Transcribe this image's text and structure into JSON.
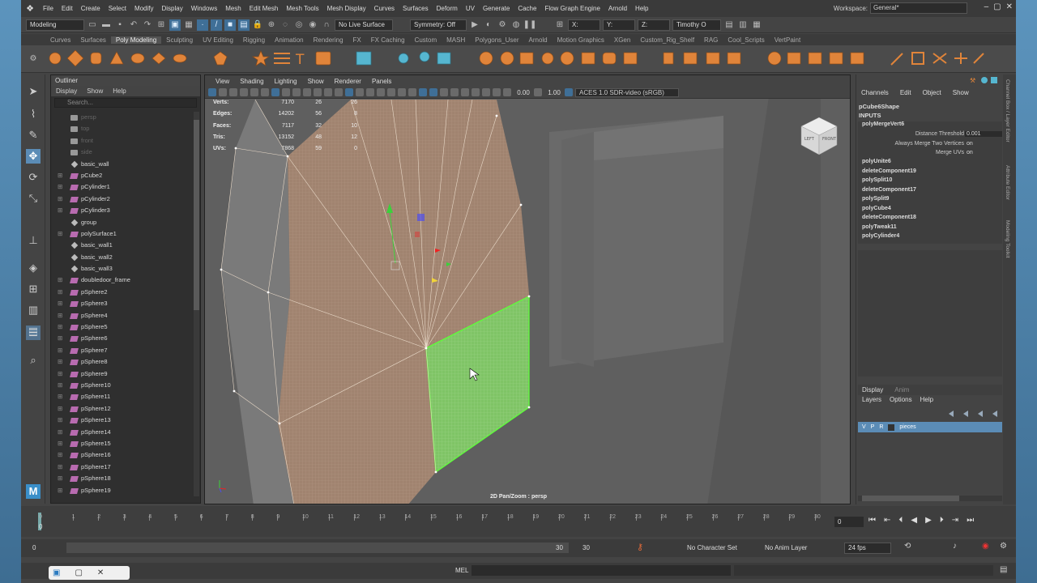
{
  "menubar": {
    "items": [
      "File",
      "Edit",
      "Create",
      "Select",
      "Modify",
      "Display",
      "Windows",
      "Mesh",
      "Edit Mesh",
      "Mesh Tools",
      "Mesh Display",
      "Curves",
      "Surfaces",
      "Deform",
      "UV",
      "Generate",
      "Cache",
      "Flow Graph Engine",
      "Arnold",
      "Help"
    ],
    "workspace_label": "Workspace:",
    "workspace_value": "General*"
  },
  "statusline": {
    "mode": "Modeling",
    "live_surface": "No Live Surface",
    "symmetry": "Symmetry: Off",
    "user": "Timothy O"
  },
  "shelf": {
    "tabs": [
      "Curves",
      "Surfaces",
      "Poly Modeling",
      "Sculpting",
      "UV Editing",
      "Rigging",
      "Animation",
      "Rendering",
      "FX",
      "FX Caching",
      "Custom",
      "MASH",
      "Polygons_User",
      "Arnold",
      "Motion Graphics",
      "XGen",
      "Custom_Rig_Shelf",
      "RAG",
      "Cool_Scripts",
      "VertPaint"
    ],
    "active_tab": "Poly Modeling"
  },
  "outliner": {
    "title": "Outliner",
    "menu": [
      "Display",
      "Show",
      "Help"
    ],
    "search_placeholder": "Search...",
    "items": [
      {
        "label": "persp",
        "icon": "cam",
        "dim": true
      },
      {
        "label": "top",
        "icon": "cam",
        "dim": true
      },
      {
        "label": "front",
        "icon": "cam",
        "dim": true
      },
      {
        "label": "side",
        "icon": "cam",
        "dim": true
      },
      {
        "label": "basic_wall",
        "icon": "grp",
        "dim": false
      },
      {
        "label": "pCube2",
        "icon": "mesh",
        "dim": false,
        "exp": true
      },
      {
        "label": "pCylinder1",
        "icon": "mesh",
        "dim": false,
        "exp": true
      },
      {
        "label": "pCylinder2",
        "icon": "mesh",
        "dim": false,
        "exp": true
      },
      {
        "label": "pCylinder3",
        "icon": "mesh",
        "dim": false,
        "exp": true
      },
      {
        "label": "group",
        "icon": "grp",
        "dim": false
      },
      {
        "label": "polySurface1",
        "icon": "mesh",
        "dim": false,
        "exp": true
      },
      {
        "label": "basic_wall1",
        "icon": "grp",
        "dim": false
      },
      {
        "label": "basic_wall2",
        "icon": "grp",
        "dim": false
      },
      {
        "label": "basic_wall3",
        "icon": "grp",
        "dim": false
      },
      {
        "label": "doubledoor_frame",
        "icon": "mesh",
        "dim": false,
        "exp": true
      },
      {
        "label": "pSphere2",
        "icon": "mesh",
        "dim": false,
        "exp": true
      },
      {
        "label": "pSphere3",
        "icon": "mesh",
        "dim": false,
        "exp": true
      },
      {
        "label": "pSphere4",
        "icon": "mesh",
        "dim": false,
        "exp": true
      },
      {
        "label": "pSphere5",
        "icon": "mesh",
        "dim": false,
        "exp": true
      },
      {
        "label": "pSphere6",
        "icon": "mesh",
        "dim": false,
        "exp": true
      },
      {
        "label": "pSphere7",
        "icon": "mesh",
        "dim": false,
        "exp": true
      },
      {
        "label": "pSphere8",
        "icon": "mesh",
        "dim": false,
        "exp": true
      },
      {
        "label": "pSphere9",
        "icon": "mesh",
        "dim": false,
        "exp": true
      },
      {
        "label": "pSphere10",
        "icon": "mesh",
        "dim": false,
        "exp": true
      },
      {
        "label": "pSphere11",
        "icon": "mesh",
        "dim": false,
        "exp": true
      },
      {
        "label": "pSphere12",
        "icon": "mesh",
        "dim": false,
        "exp": true
      },
      {
        "label": "pSphere13",
        "icon": "mesh",
        "dim": false,
        "exp": true
      },
      {
        "label": "pSphere14",
        "icon": "mesh",
        "dim": false,
        "exp": true
      },
      {
        "label": "pSphere15",
        "icon": "mesh",
        "dim": false,
        "exp": true
      },
      {
        "label": "pSphere16",
        "icon": "mesh",
        "dim": false,
        "exp": true
      },
      {
        "label": "pSphere17",
        "icon": "mesh",
        "dim": false,
        "exp": true
      },
      {
        "label": "pSphere18",
        "icon": "mesh",
        "dim": false,
        "exp": true
      },
      {
        "label": "pSphere19",
        "icon": "mesh",
        "dim": false,
        "exp": true
      }
    ]
  },
  "viewport": {
    "menu": [
      "View",
      "Shading",
      "Lighting",
      "Show",
      "Renderer",
      "Panels"
    ],
    "exposure": "0.00",
    "gamma": "1.00",
    "colorspace": "ACES 1.0 SDR-video (sRGB)",
    "camera_label": "2D Pan/Zoom : persp",
    "hud": [
      {
        "k": "Verts:",
        "a": "7170",
        "b": "26",
        "c": "26"
      },
      {
        "k": "Edges:",
        "a": "14202",
        "b": "56",
        "c": "8"
      },
      {
        "k": "Faces:",
        "a": "7117",
        "b": "32",
        "c": "10"
      },
      {
        "k": "Tris:",
        "a": "13152",
        "b": "48",
        "c": "12"
      },
      {
        "k": "UVs:",
        "a": "7868",
        "b": "59",
        "c": "0"
      }
    ],
    "viewcube": {
      "left": "LEFT",
      "front": "FRONT"
    }
  },
  "channelbox": {
    "menu": [
      "Channels",
      "Edit",
      "Object",
      "Show"
    ],
    "object": "pCube6Shape",
    "inputs_label": "INPUTS",
    "active_node": "polyMergeVert6",
    "attrs": [
      {
        "k": "Distance Threshold",
        "v": "0.001"
      },
      {
        "k": "Always Merge Two Vertices",
        "v": "on"
      },
      {
        "k": "Merge UVs",
        "v": "on"
      }
    ],
    "nodes": [
      "polyUnite6",
      "deleteComponent19",
      "polySplit10",
      "deleteComponent17",
      "polySplit9",
      "polyCube4",
      "deleteComponent18",
      "polyTweak11",
      "polyCylinder4"
    ]
  },
  "layers": {
    "tabs": [
      "Display",
      "Anim"
    ],
    "menu": [
      "Layers",
      "Options",
      "Help"
    ],
    "row": {
      "v": "V",
      "p": "P",
      "r": "R",
      "name": "pieces"
    }
  },
  "sidetabs": [
    "Channel Box / Layer Editor",
    "Attribute Editor",
    "Modeling Toolkit"
  ],
  "timeslider": {
    "ticks": [
      "1",
      "2",
      "3",
      "4",
      "5",
      "6",
      "7",
      "8",
      "9",
      "10",
      "11",
      "12",
      "13",
      "14",
      "15",
      "16",
      "17",
      "18",
      "19",
      "20",
      "21",
      "22",
      "23",
      "24",
      "25",
      "26",
      "27",
      "28",
      "29",
      "30"
    ],
    "start_label": "0",
    "current": "0"
  },
  "range": {
    "start": "0",
    "inner_start": "0",
    "inner_end": "30",
    "end": "30",
    "charset": "No Character Set",
    "animlayer": "No Anim Layer",
    "fps": "24 fps"
  },
  "cmdline": {
    "label": "MEL"
  }
}
